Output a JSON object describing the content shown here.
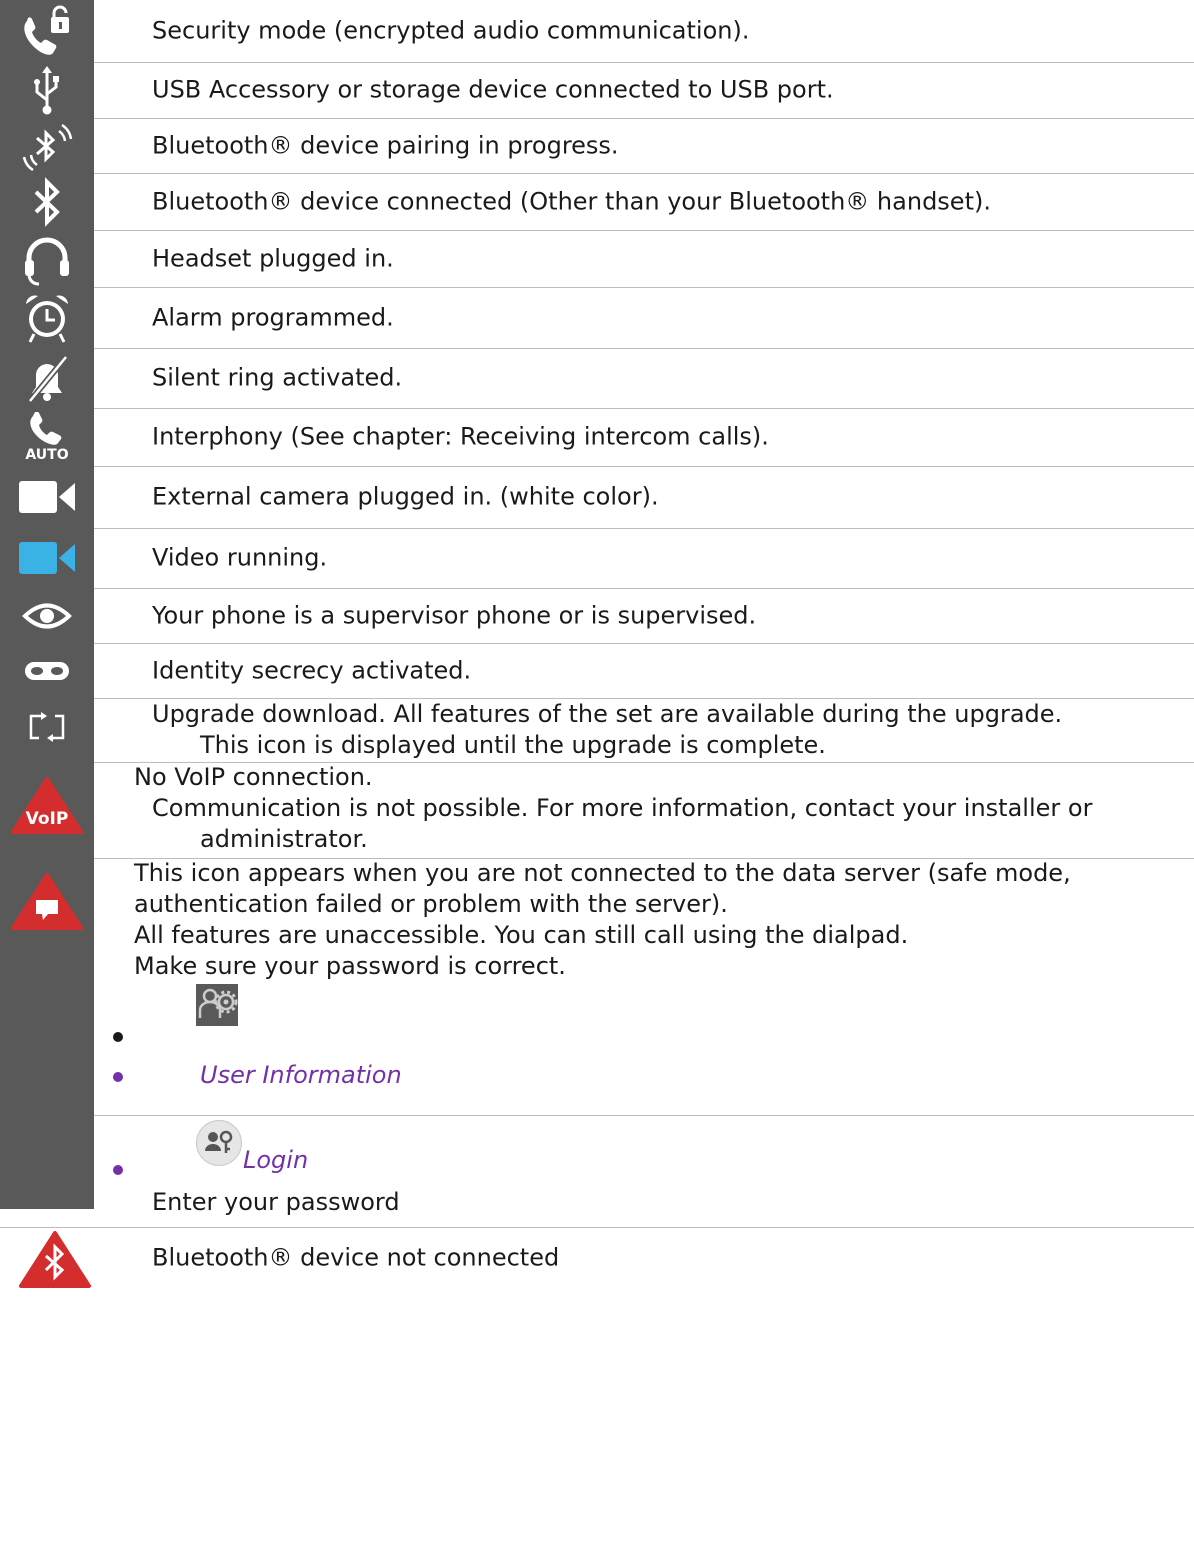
{
  "rows": [
    {
      "icon": "security-lock-phone-icon",
      "text": "Security mode (encrypted audio communication)."
    },
    {
      "icon": "usb-icon",
      "text": "USB Accessory or storage device connected to USB port."
    },
    {
      "icon": "bluetooth-pairing-icon",
      "text": "Bluetooth® device pairing in progress."
    },
    {
      "icon": "bluetooth-icon",
      "text": "Bluetooth® device connected (Other than your Bluetooth® handset)."
    },
    {
      "icon": "headset-icon",
      "text": "Headset plugged in."
    },
    {
      "icon": "alarm-clock-icon",
      "text": "Alarm programmed."
    },
    {
      "icon": "silent-bell-icon",
      "text": "Silent ring activated."
    },
    {
      "icon": "phone-auto-icon",
      "text": "Interphony (See chapter: Receiving intercom calls).",
      "badge": "AUTO"
    },
    {
      "icon": "camera-white-icon",
      "text": "External camera plugged in. (white color)."
    },
    {
      "icon": "camera-blue-icon",
      "text": "Video running."
    },
    {
      "icon": "eye-icon",
      "text": "Your phone is a supervisor phone or is supervised."
    },
    {
      "icon": "mask-icon",
      "text": "Identity secrecy activated."
    },
    {
      "icon": "upgrade-icon",
      "text1": "Upgrade download. All features of the set are available during the upgrade.",
      "text2": "This icon is displayed until the upgrade is complete."
    },
    {
      "icon": "voip-warning-icon",
      "badge": "VoIP",
      "text1": "No VoIP connection.",
      "text2": "Communication is not possible. For more information, contact your installer or",
      "text3": "administrator."
    },
    {
      "icon": "data-server-warning-icon",
      "text1": "This icon appears when you are not connected to the data server (safe mode,",
      "text2": "authentication failed or problem with the server).",
      "text3": "All features are unaccessible. You can still call using the dialpad.",
      "text4": "Make sure your password is correct.",
      "item1_icon": "user-settings-icon",
      "item2": "User Information",
      "item3_icon": "login-key-icon",
      "item3": "Login",
      "after": "Enter your password"
    },
    {
      "icon": "bluetooth-warning-icon",
      "text": "Bluetooth® device not connected"
    }
  ],
  "colors": {
    "icon_cell": "#595959",
    "accent_purple": "#7330a8",
    "warning_red": "#d42d2d",
    "video_blue": "#3ab2e6"
  }
}
